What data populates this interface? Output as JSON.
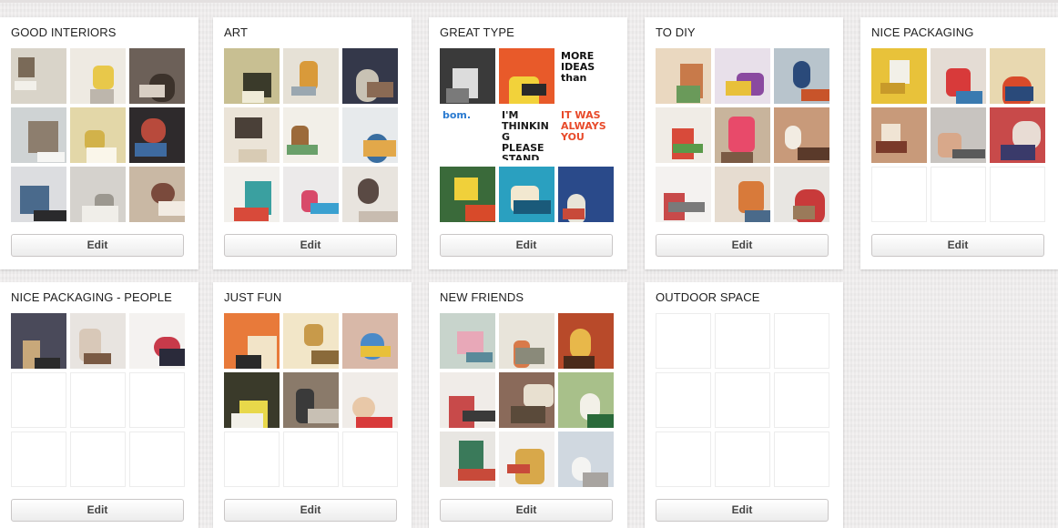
{
  "boards": [
    {
      "title": "GOOD INTERIORS",
      "edit_label": "Edit",
      "thumbs": [
        {
          "type": "image",
          "bg": "#d9d4c9",
          "accent": "#7a6a58",
          "accent2": "#f2f0ea"
        },
        {
          "type": "image",
          "bg": "#eeeae2",
          "accent": "#e8c84a",
          "accent2": "#bdb6ac"
        },
        {
          "type": "image",
          "bg": "#6c6058",
          "accent": "#3c322b",
          "accent2": "#d9cfc4"
        },
        {
          "type": "image",
          "bg": "#cfd3d4",
          "accent": "#8d7e6e",
          "accent2": "#f5f5f3"
        },
        {
          "type": "image",
          "bg": "#e3d7a8",
          "accent": "#d2b24a",
          "accent2": "#faf6ea"
        },
        {
          "type": "image",
          "bg": "#2e2a2c",
          "accent": "#b84a3c",
          "accent2": "#3e6aa0"
        },
        {
          "type": "image",
          "bg": "#dcdde0",
          "accent": "#4a6a8c",
          "accent2": "#2a2a2c"
        },
        {
          "type": "image",
          "bg": "#d5d2cd",
          "accent": "#9c9890",
          "accent2": "#f0eee9"
        },
        {
          "type": "image",
          "bg": "#c9b8a4",
          "accent": "#7a4a3c",
          "accent2": "#f2ebe2"
        }
      ]
    },
    {
      "title": "ART",
      "edit_label": "Edit",
      "thumbs": [
        {
          "type": "image",
          "bg": "#c8bf92",
          "accent": "#3a3a2a",
          "accent2": "#f0ecd8"
        },
        {
          "type": "image",
          "bg": "#e6e1d6",
          "accent": "#d99a3a",
          "accent2": "#9aa7b0"
        },
        {
          "type": "image",
          "bg": "#34384a",
          "accent": "#c8c2b4",
          "accent2": "#8a6a54"
        },
        {
          "type": "image",
          "bg": "#ebe4d8",
          "accent": "#4a4038",
          "accent2": "#d8cbb4"
        },
        {
          "type": "image",
          "bg": "#f2efe8",
          "accent": "#9c6a3a",
          "accent2": "#6aa06a"
        },
        {
          "type": "image",
          "bg": "#e7eaec",
          "accent": "#3a6ea0",
          "accent2": "#e2a84a"
        },
        {
          "type": "image",
          "bg": "#f2f0ec",
          "accent": "#3aa0a0",
          "accent2": "#d84a3a"
        },
        {
          "type": "image",
          "bg": "#eceaea",
          "accent": "#d84a6a",
          "accent2": "#3aa0d0"
        },
        {
          "type": "image",
          "bg": "#e8e4de",
          "accent": "#5a4a44",
          "accent2": "#c8bcb0"
        }
      ]
    },
    {
      "title": "GREAT TYPE",
      "edit_label": "Edit",
      "thumbs": [
        {
          "type": "image",
          "bg": "#3a3a3a",
          "accent": "#dcdcdc",
          "accent2": "#7a7a7a"
        },
        {
          "type": "image",
          "bg": "#e85a2a",
          "accent": "#f2d23a",
          "accent2": "#2a2a2a"
        },
        {
          "type": "text",
          "bg": "#ffffff",
          "color": "#111111",
          "text": "MORE IDEAS than"
        },
        {
          "type": "text",
          "bg": "#ffffff",
          "color": "#2a7ad0",
          "text": "bom."
        },
        {
          "type": "text",
          "bg": "#ffffff",
          "color": "#1a1a1a",
          "text": "I'M THINKING PLEASE STAND BY"
        },
        {
          "type": "text",
          "bg": "#ffffff",
          "color": "#e84a2a",
          "text": "IT WAS ALWAYS YOU"
        },
        {
          "type": "image",
          "bg": "#3a6a3a",
          "accent": "#f0d03a",
          "accent2": "#d84a2a"
        },
        {
          "type": "image",
          "bg": "#2aa0c0",
          "accent": "#f2e8d0",
          "accent2": "#1a5a7a"
        },
        {
          "type": "image",
          "bg": "#2a4a8a",
          "accent": "#e8e4d8",
          "accent2": "#c84a3a"
        }
      ]
    },
    {
      "title": "TO DIY",
      "edit_label": "Edit",
      "thumbs": [
        {
          "type": "image",
          "bg": "#ead8c0",
          "accent": "#c87a4a",
          "accent2": "#6a9a5a"
        },
        {
          "type": "image",
          "bg": "#e8e0ea",
          "accent": "#8a4aa0",
          "accent2": "#e8c03a"
        },
        {
          "type": "image",
          "bg": "#b8c4cc",
          "accent": "#2a4a7a",
          "accent2": "#c8542a"
        },
        {
          "type": "image",
          "bg": "#f0ece6",
          "accent": "#d84a3a",
          "accent2": "#5a9a4a"
        },
        {
          "type": "image",
          "bg": "#c8b49c",
          "accent": "#e84a6a",
          "accent2": "#7a5a44"
        },
        {
          "type": "image",
          "bg": "#c89a7a",
          "accent": "#f2ece2",
          "accent2": "#5a3a2a"
        },
        {
          "type": "image",
          "bg": "#f4f2f0",
          "accent": "#c84a4a",
          "accent2": "#7a7a7a"
        },
        {
          "type": "image",
          "bg": "#e6dcd0",
          "accent": "#d87a3a",
          "accent2": "#4a6a8a"
        },
        {
          "type": "image",
          "bg": "#e8e6e2",
          "accent": "#c83a3a",
          "accent2": "#9a7a5a"
        }
      ]
    },
    {
      "title": "NICE PACKAGING",
      "edit_label": "Edit",
      "thumbs": [
        {
          "type": "image",
          "bg": "#e8c23a",
          "accent": "#f2f0e8",
          "accent2": "#c89a2a"
        },
        {
          "type": "image",
          "bg": "#e4dcd4",
          "accent": "#d83a3a",
          "accent2": "#3a7ab0"
        },
        {
          "type": "image",
          "bg": "#e8d8b0",
          "accent": "#d84a2a",
          "accent2": "#2a4a7a"
        },
        {
          "type": "image",
          "bg": "#c89a7a",
          "accent": "#f0e4d4",
          "accent2": "#7a3a2a"
        },
        {
          "type": "image",
          "bg": "#c8c4c0",
          "accent": "#d8a88a",
          "accent2": "#5a5a5a"
        },
        {
          "type": "image",
          "bg": "#c84a4a",
          "accent": "#e8dcd4",
          "accent2": "#3a3a6a"
        },
        {
          "type": "empty"
        },
        {
          "type": "empty"
        },
        {
          "type": "empty"
        }
      ]
    },
    {
      "title": "NICE PACKAGING - PEOPLE",
      "edit_label": "Edit",
      "thumbs": [
        {
          "type": "image",
          "bg": "#4a4a5a",
          "accent": "#c8a87a",
          "accent2": "#2a2a2a"
        },
        {
          "type": "image",
          "bg": "#e8e4e0",
          "accent": "#d8c8b8",
          "accent2": "#7a5a44"
        },
        {
          "type": "image",
          "bg": "#f4f2f0",
          "accent": "#c83a4a",
          "accent2": "#2a2a3a"
        },
        {
          "type": "empty"
        },
        {
          "type": "empty"
        },
        {
          "type": "empty"
        },
        {
          "type": "empty"
        },
        {
          "type": "empty"
        },
        {
          "type": "empty"
        }
      ]
    },
    {
      "title": "JUST FUN",
      "edit_label": "Edit",
      "thumbs": [
        {
          "type": "image",
          "bg": "#e87a3a",
          "accent": "#f2e4c8",
          "accent2": "#2a2a2a"
        },
        {
          "type": "image",
          "bg": "#f2e6c8",
          "accent": "#c89a4a",
          "accent2": "#8a6a3a"
        },
        {
          "type": "image",
          "bg": "#d8b8a8",
          "accent": "#4a8ac8",
          "accent2": "#e8c03a"
        },
        {
          "type": "image",
          "bg": "#3a3a2a",
          "accent": "#e8d84a",
          "accent2": "#f2f0e8"
        },
        {
          "type": "image",
          "bg": "#8a7a6a",
          "accent": "#3a3a3a",
          "accent2": "#c8c0b4"
        },
        {
          "type": "image",
          "bg": "#f0ece8",
          "accent": "#e8c8a8",
          "accent2": "#d83a3a"
        },
        {
          "type": "empty"
        },
        {
          "type": "empty"
        },
        {
          "type": "empty"
        }
      ]
    },
    {
      "title": "NEW FRIENDS",
      "edit_label": "Edit",
      "thumbs": [
        {
          "type": "image",
          "bg": "#c8d4cc",
          "accent": "#e8a8b8",
          "accent2": "#5a8a9a"
        },
        {
          "type": "image",
          "bg": "#e8e4da",
          "accent": "#d87a4a",
          "accent2": "#8a8a7a"
        },
        {
          "type": "image",
          "bg": "#b84a2a",
          "accent": "#e8b84a",
          "accent2": "#4a2a1a"
        },
        {
          "type": "image",
          "bg": "#f0ece8",
          "accent": "#c84a4a",
          "accent2": "#3a3a3a"
        },
        {
          "type": "image",
          "bg": "#8a6a5a",
          "accent": "#e8e0d0",
          "accent2": "#5a4a3a"
        },
        {
          "type": "image",
          "bg": "#a8c08a",
          "accent": "#f2f0e8",
          "accent2": "#2a6a3a"
        },
        {
          "type": "image",
          "bg": "#e8e6e2",
          "accent": "#3a7a5a",
          "accent2": "#c84a3a"
        },
        {
          "type": "image",
          "bg": "#f2f0ee",
          "accent": "#d8a84a",
          "accent2": "#c84a3a"
        },
        {
          "type": "image",
          "bg": "#d0d8e0",
          "accent": "#f4f4f2",
          "accent2": "#a8a4a0"
        }
      ]
    },
    {
      "title": "OUTDOOR SPACE",
      "edit_label": "Edit",
      "thumbs": [
        {
          "type": "empty"
        },
        {
          "type": "empty"
        },
        {
          "type": "empty"
        },
        {
          "type": "empty"
        },
        {
          "type": "empty"
        },
        {
          "type": "empty"
        },
        {
          "type": "empty"
        },
        {
          "type": "empty"
        },
        {
          "type": "empty"
        }
      ]
    }
  ]
}
